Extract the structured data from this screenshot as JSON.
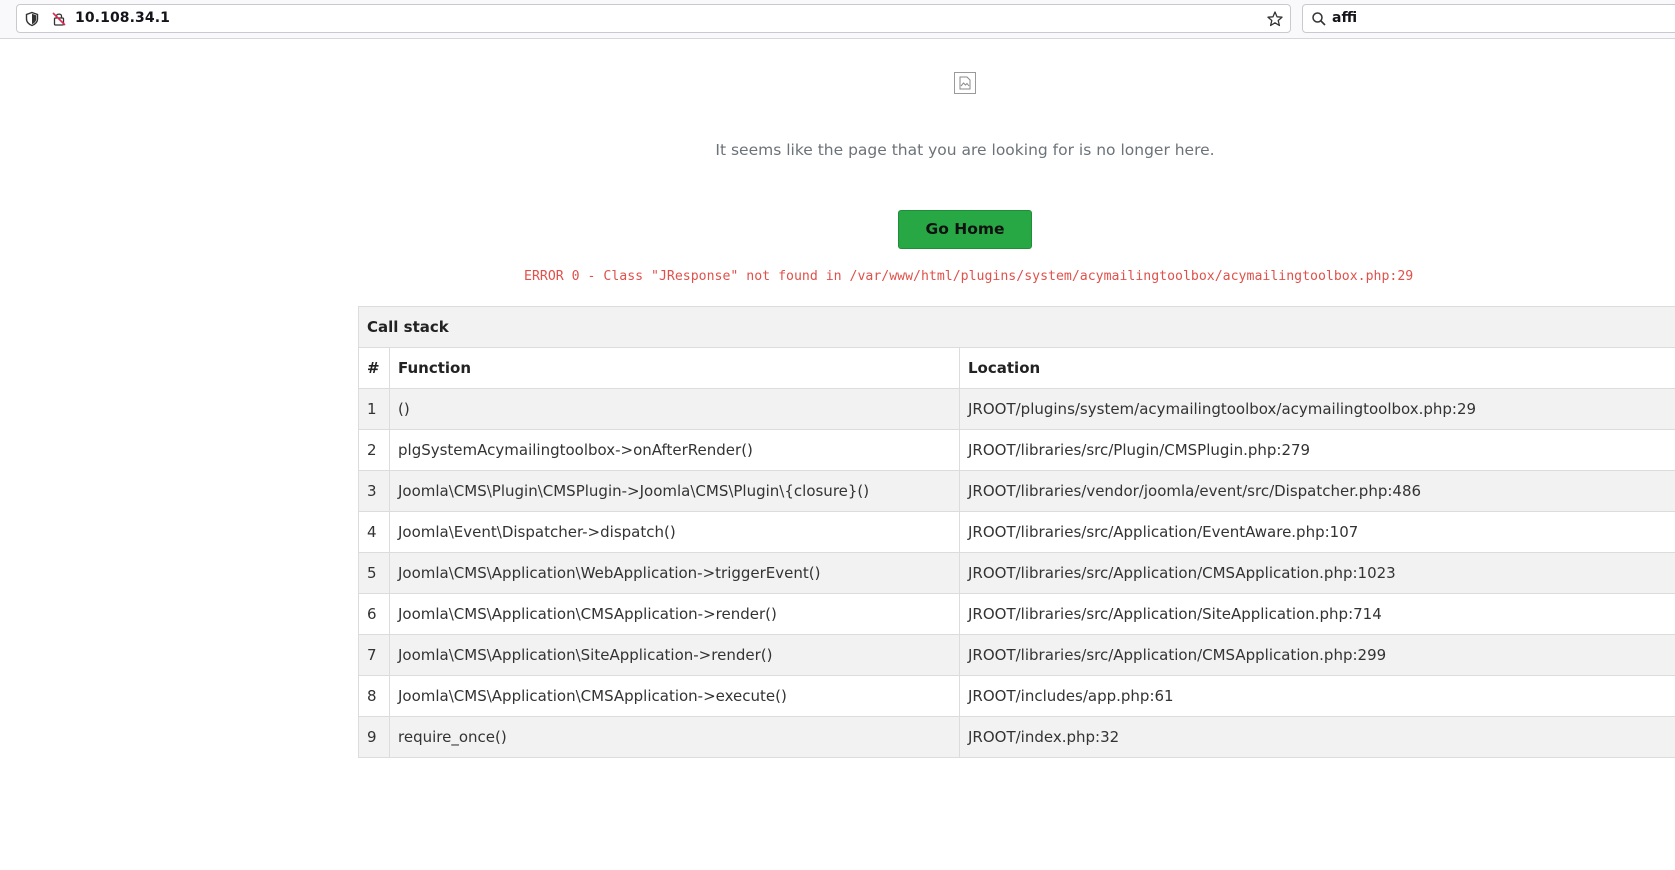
{
  "browser": {
    "url": "10.108.34.1",
    "search_query": "affi"
  },
  "page": {
    "message": "It seems like the page that you are looking for is no longer here.",
    "go_home_label": "Go Home",
    "error_text": "ERROR 0 - Class \"JResponse\" not found in /var/www/html/plugins/system/acymailingtoolbox/acymailingtoolbox.php:29"
  },
  "callstack": {
    "title": "Call stack",
    "headers": {
      "num": "#",
      "function": "Function",
      "location": "Location"
    },
    "rows": [
      {
        "num": "1",
        "function": "()",
        "location": "JROOT/plugins/system/acymailingtoolbox/acymailingtoolbox.php:29"
      },
      {
        "num": "2",
        "function": "plgSystemAcymailingtoolbox->onAfterRender()",
        "location": "JROOT/libraries/src/Plugin/CMSPlugin.php:279"
      },
      {
        "num": "3",
        "function": "Joomla\\CMS\\Plugin\\CMSPlugin->Joomla\\CMS\\Plugin\\{closure}()",
        "location": "JROOT/libraries/vendor/joomla/event/src/Dispatcher.php:486"
      },
      {
        "num": "4",
        "function": "Joomla\\Event\\Dispatcher->dispatch()",
        "location": "JROOT/libraries/src/Application/EventAware.php:107"
      },
      {
        "num": "5",
        "function": "Joomla\\CMS\\Application\\WebApplication->triggerEvent()",
        "location": "JROOT/libraries/src/Application/CMSApplication.php:1023"
      },
      {
        "num": "6",
        "function": "Joomla\\CMS\\Application\\CMSApplication->render()",
        "location": "JROOT/libraries/src/Application/SiteApplication.php:714"
      },
      {
        "num": "7",
        "function": "Joomla\\CMS\\Application\\SiteApplication->render()",
        "location": "JROOT/libraries/src/Application/CMSApplication.php:299"
      },
      {
        "num": "8",
        "function": "Joomla\\CMS\\Application\\CMSApplication->execute()",
        "location": "JROOT/includes/app.php:61"
      },
      {
        "num": "9",
        "function": "require_once()",
        "location": "JROOT/index.php:32"
      }
    ]
  },
  "colors": {
    "button_bg": "#27a844",
    "error_text": "#e0514b",
    "striped_row": "#f2f2f2"
  },
  "icons": [
    "shield-icon",
    "insecure-lock-icon",
    "bookmark-star-icon",
    "search-icon",
    "broken-image-icon"
  ]
}
